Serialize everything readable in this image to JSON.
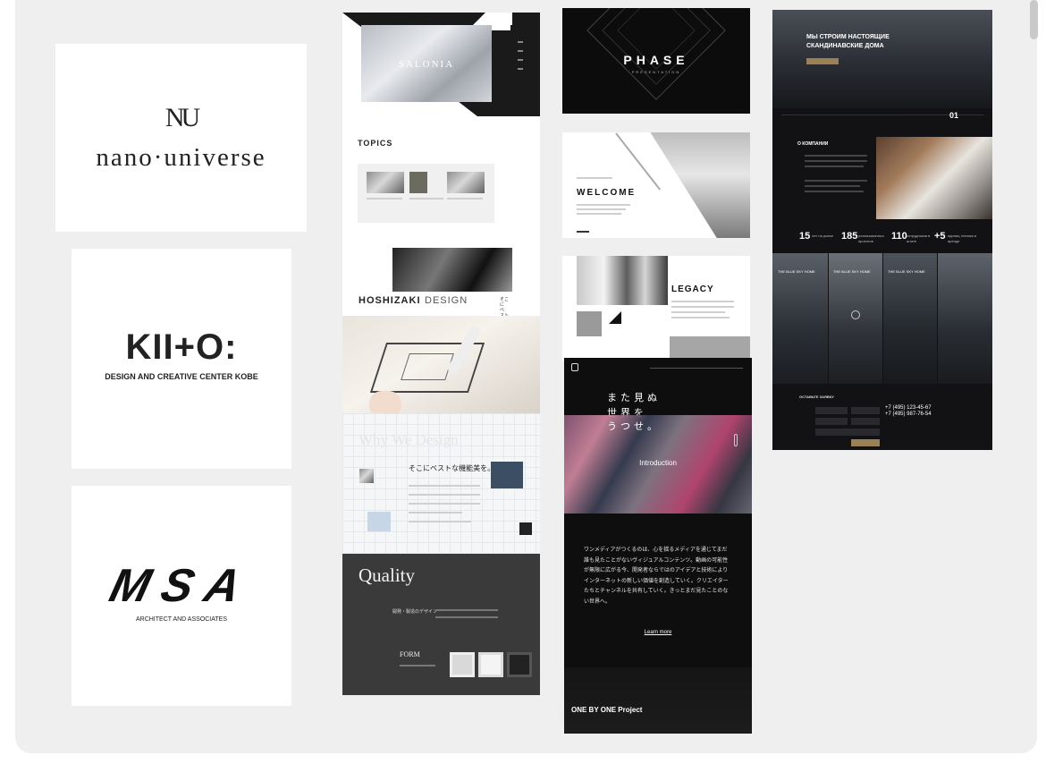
{
  "logos": {
    "nano_universe": {
      "mark": "NU",
      "name": "nano·universe"
    },
    "kiito": {
      "mark": "KII+O:",
      "subtitle": "DESIGN AND CREATIVE CENTER KOBE"
    },
    "msa": {
      "mark": "MSA",
      "subtitle": "ARCHITECT AND ASSOCIATES"
    }
  },
  "salonia": {
    "hero_text": "SALONIA",
    "topics_heading": "TOPICS"
  },
  "hoshizaki": {
    "title_bold": "HOSHIZAKI",
    "title_light": "DESIGN",
    "vertical_text": "そこにベストな機能美を",
    "why_heading": "Why We Design",
    "tagline": "そこにベストな機能美を。",
    "quality_heading": "Quality",
    "quality_sub": "開発・製造のデザイン",
    "form_heading": "FORM"
  },
  "phase": {
    "title": "PHASE",
    "subtitle": "PRESENTATION"
  },
  "welcome": {
    "title": "WELCOME"
  },
  "legacy": {
    "title": "LEGACY"
  },
  "onebyone": {
    "headline_lines": [
      "また見ぬ",
      "世界を",
      "うつせ。"
    ],
    "intro_label": "Introduction",
    "body_text": "ワンメディアがつくるのは、心を揺るメディアを通じてまだ誰も見たことがないヴィジュアルコンテンツ。動画の可能性が無限に広がる今、開発者ならではのアイデアと技術によりインターネットの新しい価値を創造していく。クリエイターたちとチャンネルを共有していく。きっとまだ見たことのない世界へ。",
    "learn_more": "Learn more",
    "project_label": "ONE BY ONE Project"
  },
  "scandi": {
    "headline": "МЫ СТРОИМ НАСТОЯЩИЕ СКАНДИНАВСКИЕ ДОМА",
    "slide_number": "01",
    "about_heading": "О КОМПАНИИ",
    "stats": [
      {
        "value": "15",
        "label": "лет на рынке"
      },
      {
        "value": "185",
        "label": "реализованных проектов"
      },
      {
        "value": "110",
        "label": "сотрудников в штате"
      },
      {
        "value": "+5",
        "label": "единиц техники в аренде"
      }
    ],
    "projects": [
      "THE BLUE SKY HOME",
      "THE BLUE SKY HOME",
      "THE BLUE SKY HOME"
    ],
    "contact_heading": "ОСТАВЬТЕ ЗАЯВКУ",
    "phones": [
      "+7 (495) 123-45-67",
      "+7 (495) 987-76-54"
    ]
  }
}
